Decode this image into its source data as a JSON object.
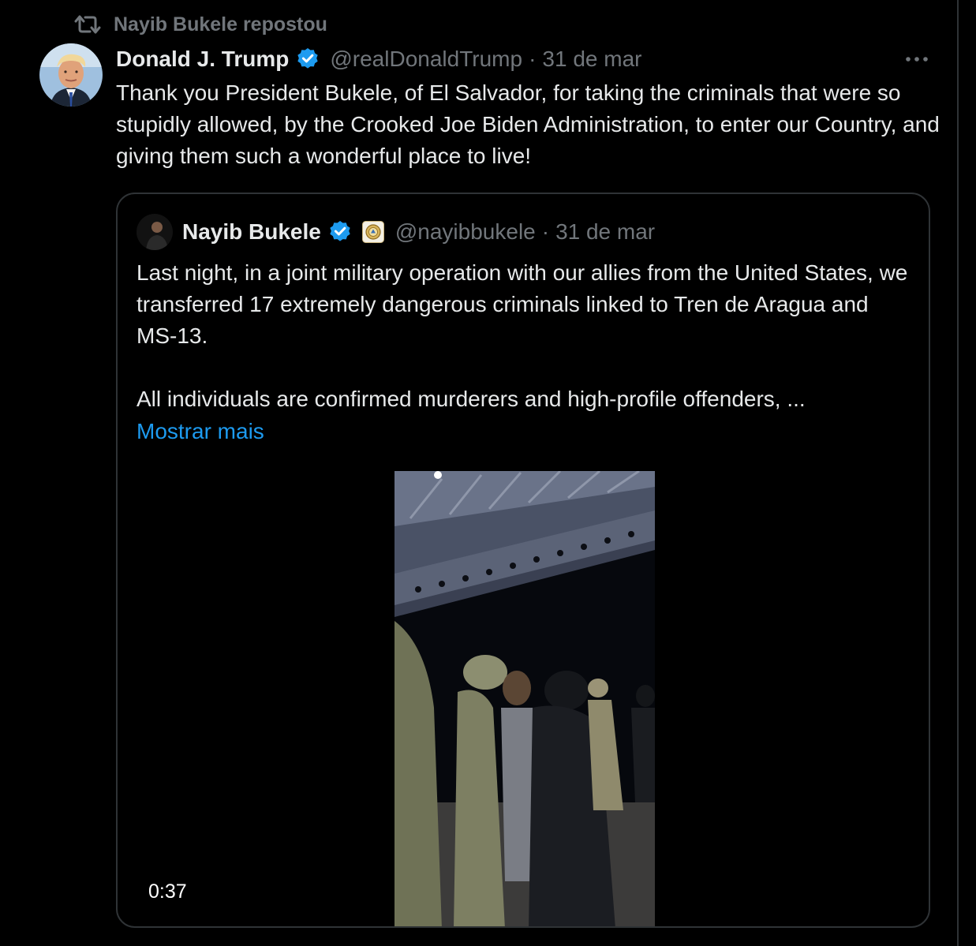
{
  "repost": {
    "label": "Nayib Bukele repostou",
    "icon": "repost-icon"
  },
  "tweet": {
    "display_name": "Donald J. Trump",
    "verified_icon": "verified-badge-icon",
    "handle": "@realDonaldTrump",
    "separator": "·",
    "date": "31 de mar",
    "more_icon": "more-options-icon",
    "text": "Thank you President Bukele, of El Salvador, for taking the criminals that were so stupidly allowed, by the Crooked Joe Biden Administration, to enter our Country, and giving them such a wonderful place to live!"
  },
  "quote": {
    "display_name": "Nayib Bukele",
    "verified_icon": "verified-badge-icon",
    "affiliate_icon": "government-seal-icon",
    "handle": "@nayibbukele",
    "separator": "·",
    "date": "31 de mar",
    "paragraph_1": "Last night, in a joint military operation with our allies from the United States, we transferred 17 extremely dangerous criminals linked to Tren de Aragua and MS-13.",
    "paragraph_2": "All individuals are confirmed murderers and high-profile offenders, ...",
    "show_more": "Mostrar mais",
    "video": {
      "duration": "0:37"
    }
  },
  "colors": {
    "background": "#000000",
    "text": "#e7e9ea",
    "muted": "#71767b",
    "border": "#2f3336",
    "link": "#1d9bf0",
    "verified": "#1d9bf0"
  }
}
